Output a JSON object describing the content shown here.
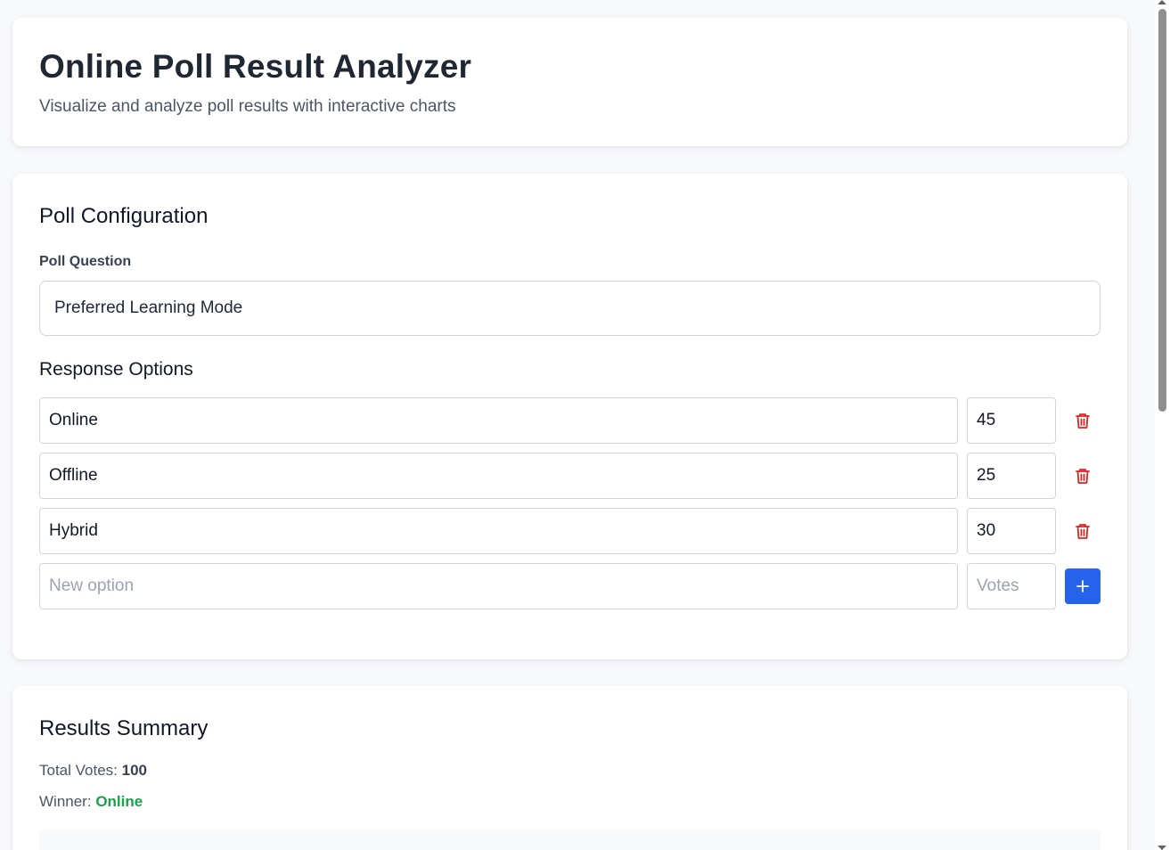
{
  "header": {
    "title": "Online Poll Result Analyzer",
    "subtitle": "Visualize and analyze poll results with interactive charts"
  },
  "config": {
    "section_title": "Poll Configuration",
    "question_label": "Poll Question",
    "question_value": "Preferred Learning Mode",
    "options_title": "Response Options",
    "options": [
      {
        "label": "Online",
        "votes": "45"
      },
      {
        "label": "Offline",
        "votes": "25"
      },
      {
        "label": "Hybrid",
        "votes": "30"
      }
    ],
    "new_option_placeholder": "New option",
    "new_votes_placeholder": "Votes",
    "add_icon": "plus-icon",
    "delete_icon": "trash-icon"
  },
  "results": {
    "section_title": "Results Summary",
    "total_label": "Total Votes:",
    "total_value": "100",
    "winner_label": "Winner:",
    "winner_value": "Online"
  },
  "colors": {
    "accent": "#2563eb",
    "danger": "#dc2626",
    "winner": "#16a34a"
  }
}
